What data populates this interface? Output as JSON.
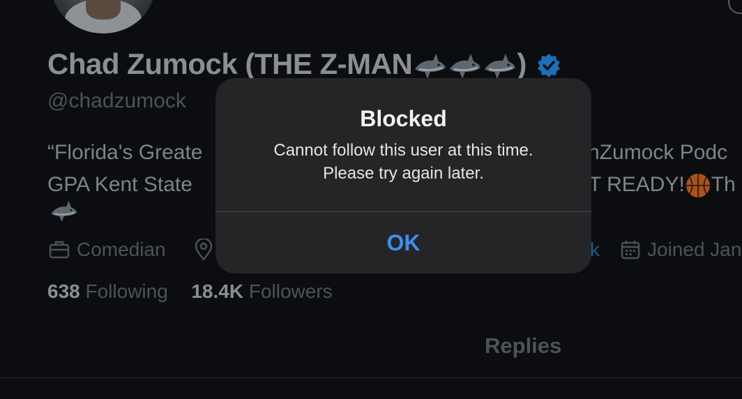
{
  "profile": {
    "display_name_prefix": "Chad Zumock (THE Z-MAN ",
    "display_name_suffix": ")",
    "handle": "@chadzumock",
    "bio_line1_left": "“Florida's Greate",
    "bio_line1_right": "nZumock Podc",
    "bio_line2_left": "GPA Kent State",
    "bio_line2_right_a": "T READY! ",
    "bio_line2_right_b": " Th"
  },
  "meta": {
    "occupation": "Comedian",
    "link_fragment": "k",
    "joined": "Joined Jan"
  },
  "counts": {
    "following_value": "638",
    "following_label": " Following",
    "followers_value": "18.4K",
    "followers_label": " Followers"
  },
  "tabs": {
    "replies": "Replies"
  },
  "alert": {
    "title": "Blocked",
    "message_line1": "Cannot follow this user at this time.",
    "message_line2": "Please try again later.",
    "ok_label": "OK"
  },
  "colors": {
    "background": "#0b0d11",
    "alert_bg": "#252527",
    "ok_blue": "#3d8ef2",
    "verified_blue": "#1d6fb8"
  },
  "icons": [
    "verified-badge-icon",
    "shark-emoji-icon",
    "basketball-emoji-icon",
    "briefcase-icon",
    "location-pin-icon",
    "calendar-icon"
  ]
}
